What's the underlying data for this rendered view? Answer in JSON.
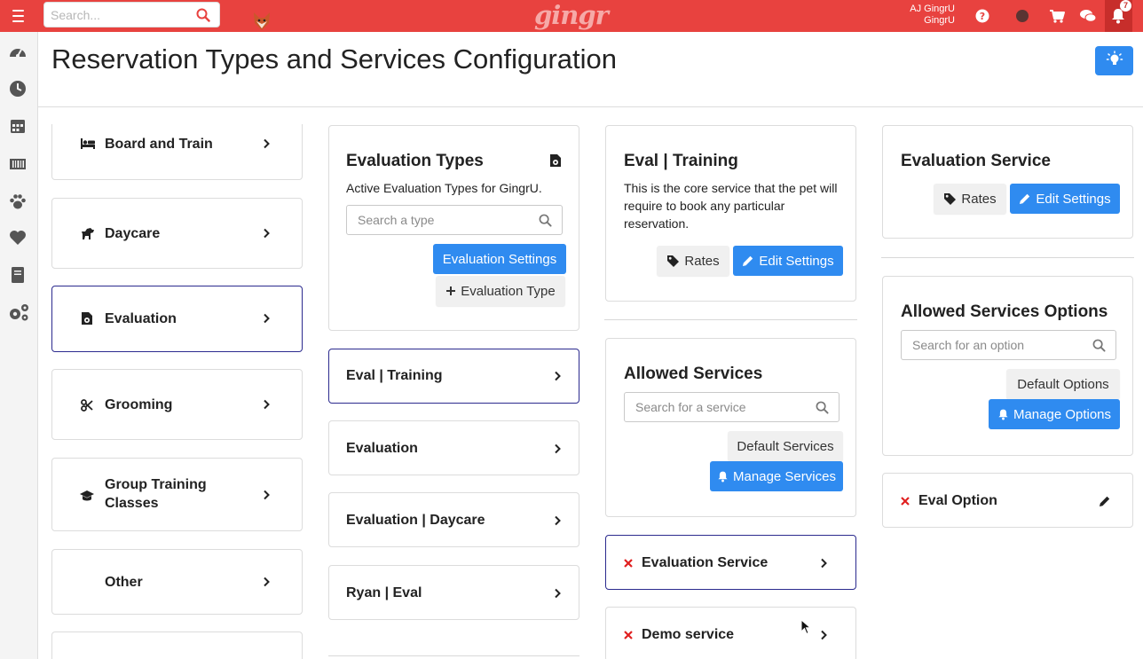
{
  "colors": {
    "brand": "#e8423f",
    "primary": "#2f8bf0",
    "selected_border": "#2b2a8e",
    "remove": "#e02020"
  },
  "topbar": {
    "search_placeholder": "Search...",
    "logo": "gingr",
    "user_line1": "AJ GingrU",
    "user_line2": "GingrU",
    "notification_count": "7",
    "icons": [
      "menu-icon",
      "search-icon",
      "help-icon",
      "status-icon",
      "cart-icon",
      "chat-icon",
      "bell-icon"
    ]
  },
  "sidebar": {
    "icons": [
      "dashboard-icon",
      "clock-icon",
      "calendar-icon",
      "barcode-icon",
      "paw-icon",
      "heart-icon",
      "book-icon",
      "gears-icon"
    ]
  },
  "page": {
    "title": "Reservation Types and Services Configuration"
  },
  "reservation_types": [
    {
      "label": "Board and Train",
      "icon": "bed-icon"
    },
    {
      "label": "Daycare",
      "icon": "dog-icon"
    },
    {
      "label": "Evaluation",
      "icon": "evaluation-icon"
    },
    {
      "label": "Grooming",
      "icon": "scissors-icon"
    },
    {
      "label": "Group Training Classes",
      "icon": "graduation-cap-icon"
    },
    {
      "label": "Other",
      "icon": ""
    }
  ],
  "evaluation_types": {
    "title": "Evaluation Types",
    "subtitle": "Active Evaluation Types for GingrU.",
    "search_placeholder": "Search a type",
    "settings_button": "Evaluation Settings",
    "add_button": "Evaluation Type",
    "items": [
      "Eval | Training",
      "Evaluation",
      "Evaluation | Daycare",
      "Ryan | Eval"
    ]
  },
  "eval_training": {
    "title": "Eval | Training",
    "description": "This is the core service that the pet will require to book any particular reservation.",
    "rates_button": "Rates",
    "edit_button": "Edit Settings"
  },
  "allowed_services": {
    "title": "Allowed Services",
    "search_placeholder": "Search for a service",
    "default_button": "Default Services",
    "manage_button": "Manage Services",
    "items": [
      "Evaluation Service",
      "Demo service"
    ]
  },
  "evaluation_service": {
    "title": "Evaluation Service",
    "rates_button": "Rates",
    "edit_button": "Edit Settings"
  },
  "allowed_options": {
    "title": "Allowed Services Options",
    "search_placeholder": "Search for an option",
    "default_button": "Default Options",
    "manage_button": "Manage Options",
    "items": [
      "Eval Option"
    ]
  }
}
